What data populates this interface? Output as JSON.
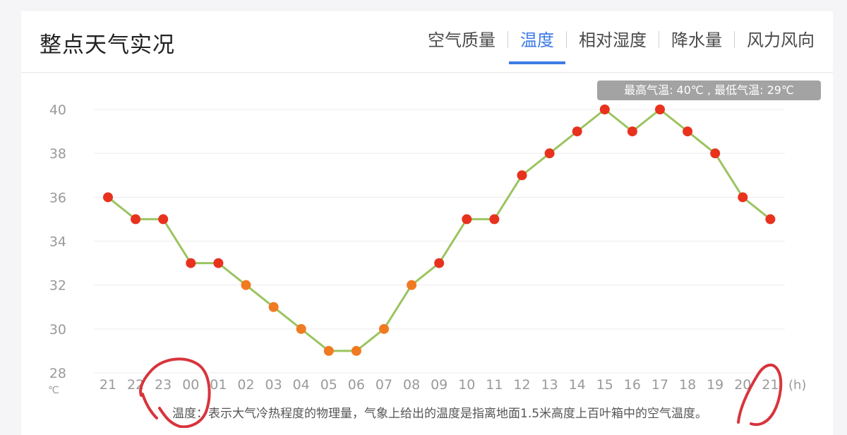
{
  "header": {
    "title": "整点天气实况",
    "tabs": [
      {
        "label": "空气质量",
        "active": false
      },
      {
        "label": "温度",
        "active": true
      },
      {
        "label": "相对湿度",
        "active": false
      },
      {
        "label": "降水量",
        "active": false
      },
      {
        "label": "风力风向",
        "active": false
      }
    ]
  },
  "tooltip": "最高气温: 40℃ , 最低气温: 29℃",
  "note": "温度：表示大气冷热程度的物理量，气象上给出的温度是指离地面1.5米高度上百叶箱中的空气温度。",
  "colors": {
    "accent": "#3d7be6",
    "line": "#9bc45f",
    "point_hot": "#e8321e",
    "point_cool": "#f07a22",
    "grid": "#ececec",
    "axis_text": "#9a9a9a",
    "annotation": "#d8343c"
  },
  "chart_data": {
    "type": "line",
    "categories": [
      "21",
      "22",
      "23",
      "00",
      "01",
      "02",
      "03",
      "04",
      "05",
      "06",
      "07",
      "08",
      "09",
      "10",
      "11",
      "12",
      "13",
      "14",
      "15",
      "16",
      "17",
      "18",
      "19",
      "20",
      "21"
    ],
    "values": [
      36,
      35,
      35,
      33,
      33,
      32,
      31,
      30,
      29,
      29,
      30,
      32,
      33,
      35,
      35,
      37,
      38,
      39,
      40,
      39,
      40,
      39,
      38,
      36,
      35
    ],
    "yticks": [
      "40",
      "38",
      "36",
      "34",
      "32",
      "30",
      "28"
    ],
    "ylim": [
      28,
      40
    ],
    "yunit": "℃",
    "xunit": "(h)",
    "grid": true
  }
}
